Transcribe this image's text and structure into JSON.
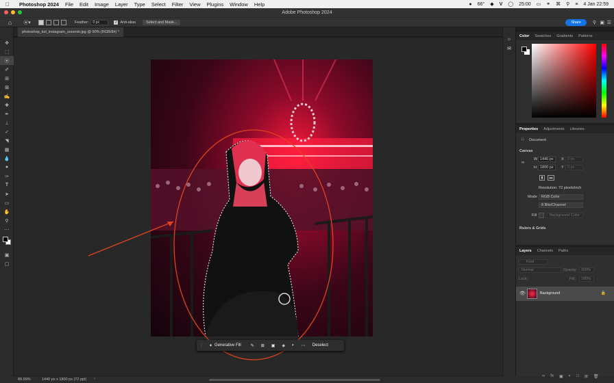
{
  "menubar": {
    "app_name": "Photoshop 2024",
    "items": [
      "File",
      "Edit",
      "Image",
      "Layer",
      "Type",
      "Select",
      "Filter",
      "View",
      "Plugins",
      "Window",
      "Help"
    ],
    "status_temp": "66°",
    "time": "25:00",
    "date_time": "4 Jan  22:59"
  },
  "title": "Adobe Photoshop 2024",
  "options": {
    "feather_label": "Feather:",
    "feather_value": "0 px",
    "anti_alias_label": "Anti-alias",
    "select_mask_label": "Select and Mask...",
    "share_label": "Share"
  },
  "document": {
    "tab_title": "photoshop_kol_instagram_sooxnie.jpg @ 90% (RGB/8#) *",
    "zoom": "89.99%",
    "dimensions": "1440 px x 1800 px (72 ppi)"
  },
  "contextbar": {
    "generative_fill": "Generative Fill",
    "deselect": "Deselect"
  },
  "color_panel": {
    "tabs": [
      "Color",
      "Swatches",
      "Gradients",
      "Patterns"
    ]
  },
  "properties_panel": {
    "tabs": [
      "Properties",
      "Adjustments",
      "Libraries"
    ],
    "document_label": "Document",
    "canvas_label": "Canvas",
    "w_label": "W",
    "w_value": "1440 px",
    "h_label": "H",
    "h_value": "1800 px",
    "x_label": "X",
    "x_value": "0 px",
    "y_label": "Y",
    "y_value": "0 px",
    "resolution": "Resolution: 72 pixels/inch",
    "mode_label": "Mode",
    "mode_value": "RGB Color",
    "bits_value": "8 Bits/Channel",
    "fill_label": "Fill",
    "fill_value": "Background Color",
    "rulers_label": "Rulers & Grids"
  },
  "layers_panel": {
    "tabs": [
      "Layers",
      "Channels",
      "Paths"
    ],
    "kind_placeholder": "Kind",
    "blend_mode": "Normal",
    "opacity_label": "Opacity:",
    "opacity_value": "100%",
    "lock_label": "Lock:",
    "fill_label": "Fill:",
    "fill_value": "100%",
    "layer_name": "Background"
  },
  "colors": {
    "accent": "#1473e6",
    "annotation": "#e0441c"
  }
}
